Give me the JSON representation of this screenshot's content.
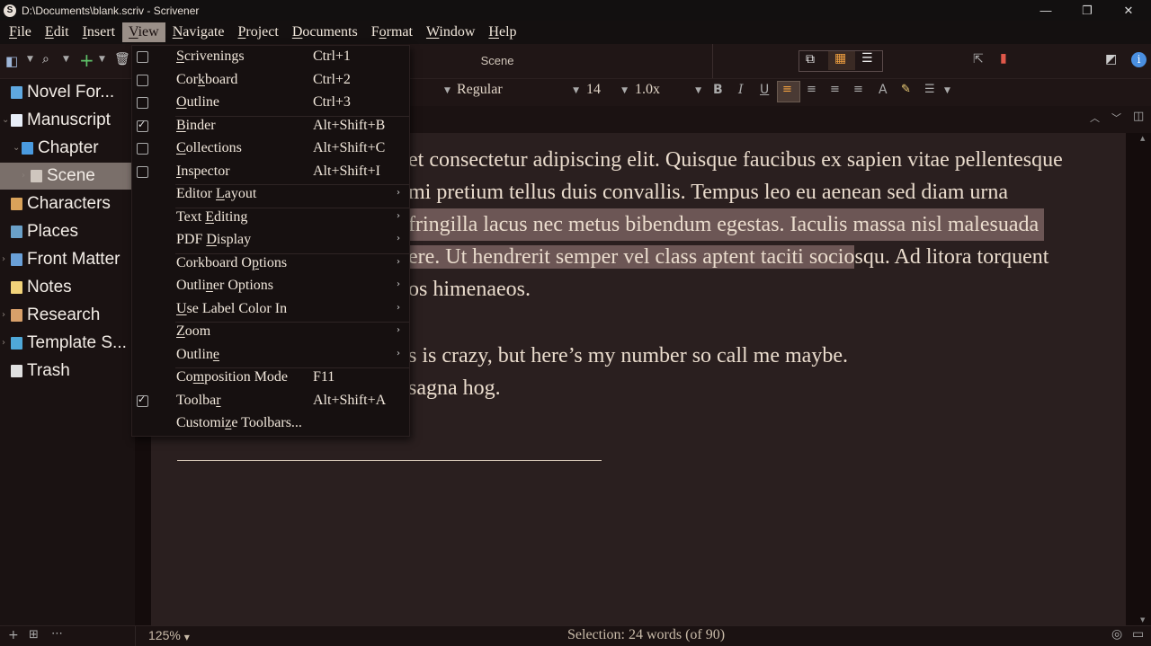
{
  "window": {
    "title": "D:\\Documents\\blank.scriv - Scrivener",
    "app_icon": "S",
    "controls": {
      "minimize": "—",
      "restore": "❐",
      "close": "✕"
    }
  },
  "menubar": {
    "items": [
      {
        "label": "File",
        "u": "F",
        "rest": "ile"
      },
      {
        "label": "Edit",
        "u": "E",
        "rest": "dit"
      },
      {
        "label": "Insert",
        "u": "I",
        "rest": "nsert"
      },
      {
        "label": "View",
        "u": "V",
        "rest": "iew"
      },
      {
        "label": "Navigate",
        "u": "N",
        "rest": "avigate"
      },
      {
        "label": "Project",
        "u": "P",
        "rest": "roject"
      },
      {
        "label": "Documents",
        "u": "D",
        "rest": "ocuments"
      },
      {
        "label": "Format",
        "u": "o",
        "pre": "F",
        "rest": "rmat"
      },
      {
        "label": "Window",
        "u": "W",
        "rest": "indow"
      },
      {
        "label": "Help",
        "u": "H",
        "rest": "elp"
      }
    ]
  },
  "toolbar": {
    "doc_title": "Scene"
  },
  "format_bar": {
    "font_style": "Regular",
    "font_size": "14",
    "line_spacing": "1.0x"
  },
  "binder": {
    "items": [
      {
        "label": "Novel For...",
        "icon": "novel-format-icon",
        "color": "#5fa8e0"
      },
      {
        "label": "Manuscript",
        "icon": "manuscript-icon",
        "color": "#e8eef8"
      },
      {
        "label": "Chapter",
        "icon": "chapter-folder-icon",
        "color": "#4a9be0"
      },
      {
        "label": "Scene",
        "icon": "scene-document-icon",
        "color": "#cfc6be"
      },
      {
        "label": "Characters",
        "icon": "characters-icon",
        "color": "#d9a25a"
      },
      {
        "label": "Places",
        "icon": "places-icon",
        "color": "#6aa0c8"
      },
      {
        "label": "Front Matter",
        "icon": "front-matter-icon",
        "color": "#6aa0d8"
      },
      {
        "label": "Notes",
        "icon": "notes-icon",
        "color": "#f2d37a"
      },
      {
        "label": "Research",
        "icon": "research-icon",
        "color": "#d8a06a"
      },
      {
        "label": "Template S...",
        "icon": "template-sheets-icon",
        "color": "#4fa8d8"
      },
      {
        "label": "Trash",
        "icon": "trash-icon",
        "color": "#e0e0e0"
      }
    ]
  },
  "editor": {
    "lines": [
      {
        "pre": "",
        "text": "et consectetur adipiscing elit. Quisque faucibus ex sapien vitae pellentesque"
      },
      {
        "text": "mi pretium tellus duis convallis. Tempus leo eu aenean sed diam urna"
      },
      {
        "text": "fringilla lacus nec metus bibendum egestas. Iaculis massa nisl malesuada"
      },
      {
        "hl": "ere. Ut hendrerit semper vel class aptent taciti socio",
        "text": "squ. Ad litora torquent"
      },
      {
        "text": "os himenaeos."
      },
      {
        "text": "s is crazy, but here’s my number so call me maybe."
      },
      {
        "text": "sagna hog."
      }
    ]
  },
  "view_menu": {
    "items": [
      {
        "pre": "",
        "u": "S",
        "rest": "crivenings",
        "shortcut": "Ctrl+1",
        "check": "off"
      },
      {
        "pre": "Cor",
        "u": "k",
        "rest": "board",
        "shortcut": "Ctrl+2",
        "check": "off"
      },
      {
        "pre": "",
        "u": "O",
        "rest": "utline",
        "shortcut": "Ctrl+3",
        "check": "off"
      },
      {
        "pre": "",
        "u": "B",
        "rest": "inder",
        "shortcut": "Alt+Shift+B",
        "check": "on"
      },
      {
        "pre": "",
        "u": "C",
        "rest": "ollections",
        "shortcut": "Alt+Shift+C",
        "check": "off"
      },
      {
        "pre": "",
        "u": "I",
        "rest": "nspector",
        "shortcut": "Alt+Shift+I",
        "check": "off"
      },
      {
        "pre": "Editor ",
        "u": "L",
        "rest": "ayout",
        "shortcut": "",
        "submenu": true
      },
      {
        "pre": "Text ",
        "u": "E",
        "rest": "diting",
        "shortcut": "",
        "submenu": true
      },
      {
        "pre": "PDF ",
        "u": "D",
        "rest": "isplay",
        "shortcut": "",
        "submenu": true
      },
      {
        "pre": "Corkboard O",
        "u": "p",
        "rest": "tions",
        "shortcut": "",
        "submenu": true
      },
      {
        "pre": "Outli",
        "u": "n",
        "rest": "er Options",
        "shortcut": "",
        "submenu": true
      },
      {
        "pre": "",
        "u": "U",
        "rest": "se Label Color In",
        "shortcut": "",
        "submenu": true
      },
      {
        "pre": "",
        "u": "Z",
        "rest": "oom",
        "shortcut": "",
        "submenu": true
      },
      {
        "pre": "Outlin",
        "u": "e",
        "rest": "",
        "shortcut": "",
        "submenu": true
      },
      {
        "pre": "Co",
        "u": "m",
        "rest": "position Mode",
        "shortcut": "F11"
      },
      {
        "pre": "Toolba",
        "u": "r",
        "rest": "",
        "shortcut": "Alt+Shift+A",
        "check": "on"
      },
      {
        "pre": "Customi",
        "u": "z",
        "rest": "e Toolbars...",
        "shortcut": ""
      }
    ]
  },
  "status": {
    "zoom": "125%",
    "selection": "Selection: 24 words (of 90)"
  },
  "colors": {
    "background": "#1b1212",
    "editor_bg": "#2a1f1f",
    "selection": "#6c5655",
    "menu_highlight": "#9a8f88",
    "bookmark": "#e0584a"
  }
}
